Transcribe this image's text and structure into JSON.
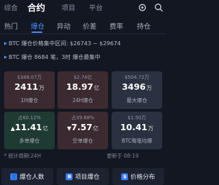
{
  "topnav": {
    "tabs": [
      "综合",
      "合约",
      "项目",
      "平台"
    ],
    "active": "合约",
    "icons": [
      "gear-icon",
      "search-icon"
    ]
  },
  "subtabs": [
    "热门",
    "爆仓",
    "异动",
    "价差",
    "费率",
    "持仓"
  ],
  "active_subtab": "爆仓",
  "info": [
    "BTC 爆仓价格集中区间: $26743 ~ $29674",
    "BTC 爆仓 8684 笔，3时 爆仓最集中"
  ],
  "cards": [
    {
      "sub": "$348.07万",
      "value": "2411",
      "unit": "万",
      "label": "1H爆仓",
      "color": "#3b2a2f"
    },
    {
      "sub": "$2.74亿",
      "value": "18.97",
      "unit": "亿",
      "label": "24H爆仓",
      "color": "#3b2a2f"
    },
    {
      "sub": "$504.72万",
      "value": "3496",
      "unit": "万",
      "label": "最大爆仓",
      "color": "#2a3140"
    },
    {
      "sub": "占60.12%",
      "value": "11.41",
      "unit": "亿",
      "label": "多单爆仓",
      "color": "#1f3a33"
    },
    {
      "sub": "占39.88%",
      "value": "7.57",
      "unit": "亿",
      "label": "空单爆仓",
      "color": "#3b2a2f"
    },
    {
      "sub": "$1.50万",
      "value": "10.41",
      "unit": "万",
      "label": "BTC每笔均爆",
      "color": "#2a3140"
    }
  ],
  "footnote": {
    "left": "* 统计周期:24H",
    "right": "更新于 08:19"
  },
  "buttons": [
    {
      "icon": "user-icon",
      "label": "爆仓人数"
    },
    {
      "icon": "b-icon",
      "label": "项目爆仓"
    },
    {
      "icon": "price-icon",
      "label": "价格分布"
    }
  ]
}
